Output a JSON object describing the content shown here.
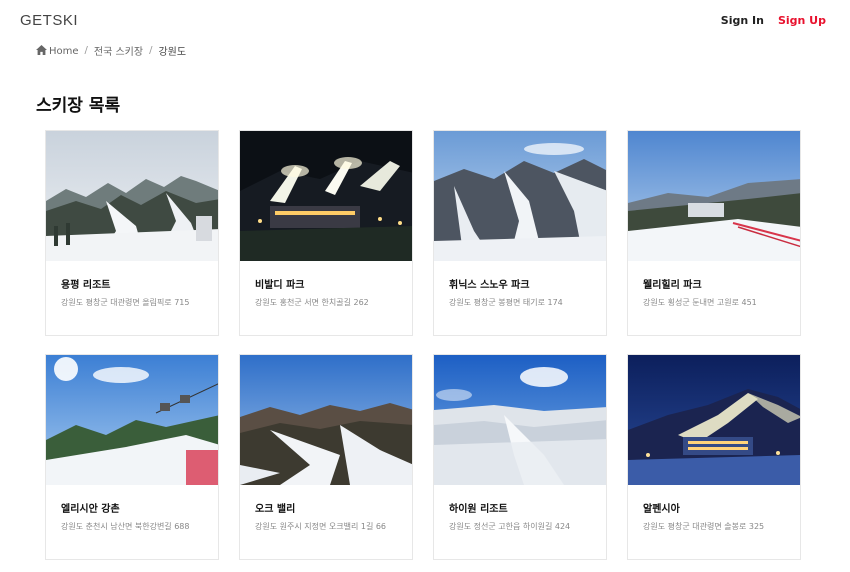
{
  "header": {
    "brand": "GETSKI",
    "sign_in": "Sign In",
    "sign_up": "Sign Up"
  },
  "breadcrumb": {
    "home": "Home",
    "level1": "전국 스키장",
    "level2": "강원도",
    "separator": "/"
  },
  "page_title": "스키장 목록",
  "resorts": [
    {
      "name": "용평 리조트",
      "address": "강원도 평창군 대관령면 올림픽로 715"
    },
    {
      "name": "비발디 파크",
      "address": "강원도 홍천군 서면 한치골길 262"
    },
    {
      "name": "휘닉스 스노우 파크",
      "address": "강원도 평창군 봉평면 태기로 174"
    },
    {
      "name": "웰리힐리 파크",
      "address": "강원도 횡성군 둔내면 고원로 451"
    },
    {
      "name": "엘리시안 강촌",
      "address": "강원도 춘천시 남산면 북한강변길 688"
    },
    {
      "name": "오크 밸리",
      "address": "강원도 원주시 지정면 오크밸리 1길 66"
    },
    {
      "name": "하이원 리조트",
      "address": "강원도 정선군 고한읍 하이원길 424"
    },
    {
      "name": "알펜시아",
      "address": "강원도 평창군 대관령면 솔봉로 325"
    }
  ]
}
